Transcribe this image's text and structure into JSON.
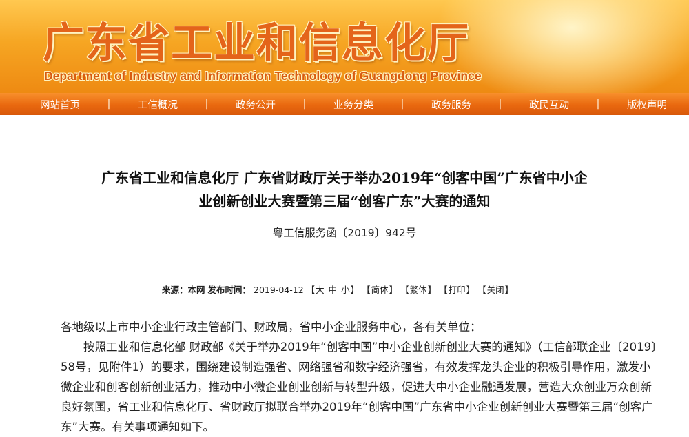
{
  "header": {
    "title_cn": "广东省工业和信息化厅",
    "title_en": "Department of Industry and Information Technology of Guangdong Province"
  },
  "nav": {
    "items": [
      "网站首页",
      "工信概况",
      "政务公开",
      "业务分类",
      "政务服务",
      "政民互动",
      "版权声明"
    ],
    "separator": "|"
  },
  "article": {
    "title_line1": "广东省工业和信息化厅 广东省财政厅关于举办2019年“创客中国”广东省中小企",
    "title_line2": "业创新创业大赛暨第三届“创客广东”大赛的通知",
    "doc_number": "粤工信服务函〔2019〕942号",
    "meta": {
      "source_label": "来源：",
      "source": "本网",
      "date_label": "发布时间：",
      "date": "2019-04-12",
      "font_large": "大",
      "font_medium": "中",
      "font_small": "小",
      "simplified": "简体",
      "traditional": "繁体",
      "print": "打印",
      "close": "关闭"
    },
    "salutation": "各地级以上市中小企业行政主管部门、财政局，省中小企业服务中心，各有关单位：",
    "paragraph1": "按照工业和信息化部 财政部《关于举办2019年“创客中国”中小企业创新创业大赛的通知》（工信部联企业〔2019〕58号，见附件1）的要求，围绕建设制造强省、网络强省和数字经济强省，有效发挥龙头企业的积极引导作用，激发小微企业和创客创新创业活力，推动中小微企业创业创新与转型升级，促进大中小企业融通发展，营造大众创业万众创新良好氛围，省工业和信息化厅、省财政厅拟联合举办2019年“创客中国”广东省中小企业创新创业大赛暨第三届“创客广东”大赛。有关事项通知如下。"
  },
  "colors": {
    "banner_orange": "#f6a623",
    "nav_orange": "#e9680f",
    "title_orange": "#e4641a"
  }
}
